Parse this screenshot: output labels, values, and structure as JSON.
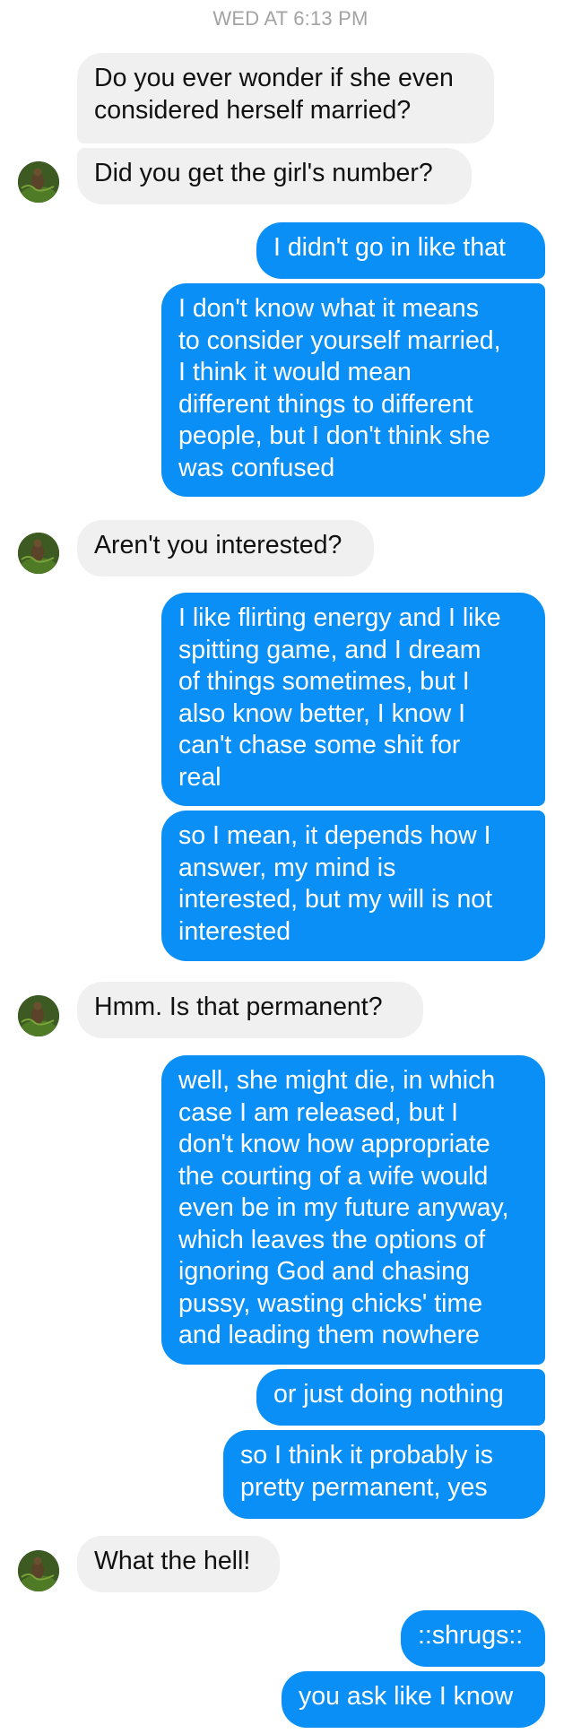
{
  "header": {
    "timestamp": "WED AT 6:13 PM"
  },
  "conversation": {
    "contact_avatar": "contact-avatar-photo",
    "colors": {
      "incoming_bubble": "#f1f0f0",
      "outgoing_bubble": "#0a8ff7",
      "outgoing_text": "#ffffff",
      "timestamp_text": "#a3a3a3"
    },
    "messages": [
      {
        "side": "in",
        "text": "Do you ever wonder if she even\nconsidered herself married?"
      },
      {
        "side": "in",
        "text": "Did you get the girl's number?"
      },
      {
        "side": "out",
        "text": "I didn't go in like that"
      },
      {
        "side": "out",
        "text": "I don't know what it means\nto consider yourself married,\nI think it would mean\ndifferent things to different\npeople, but I don't think she\nwas confused"
      },
      {
        "side": "in",
        "text": "Aren't you interested?"
      },
      {
        "side": "out",
        "text": "I like flirting energy and I like\nspitting game, and I dream\nof things sometimes, but I\nalso know better, I know I\ncan't chase some shit for\nreal"
      },
      {
        "side": "out",
        "text": "so I mean, it depends how I\nanswer, my mind is\ninterested, but my will is not\ninterested"
      },
      {
        "side": "in",
        "text": "Hmm. Is that permanent?"
      },
      {
        "side": "out",
        "text": "well, she might die, in which\ncase I am released, but I\ndon't know how appropriate\nthe courting of a wife would\neven be in my future anyway,\nwhich leaves the options of\nignoring God and chasing\npussy, wasting chicks' time\nand leading them nowhere"
      },
      {
        "side": "out",
        "text": "or just doing nothing"
      },
      {
        "side": "out",
        "text": "so I think it probably is\npretty permanent, yes"
      },
      {
        "side": "in",
        "text": "What the hell!"
      },
      {
        "side": "out",
        "text": "::shrugs::"
      },
      {
        "side": "out",
        "text": "you ask like I know"
      }
    ]
  }
}
